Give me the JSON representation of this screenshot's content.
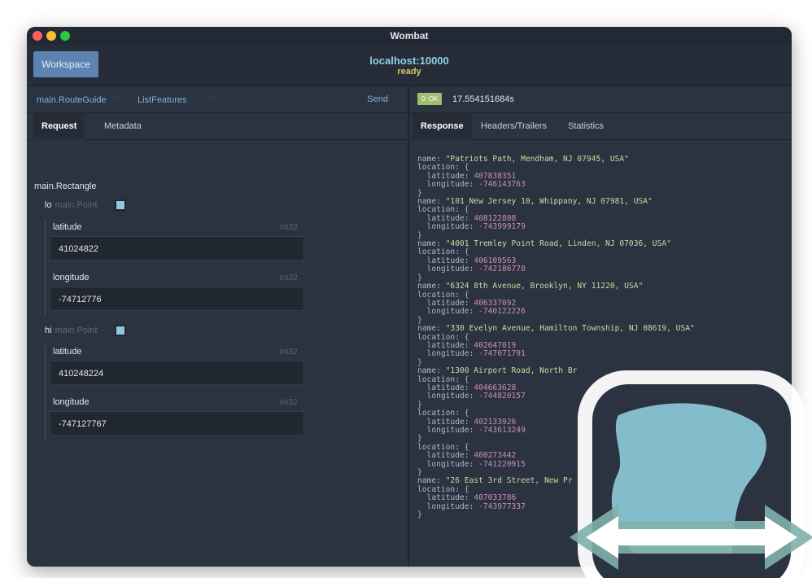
{
  "window": {
    "title": "Wombat"
  },
  "header": {
    "workspace_label": "Workspace",
    "host": "localhost:10000",
    "status": "ready"
  },
  "method_bar": {
    "service": "main.RouteGuide",
    "method": "ListFeatures",
    "send_label": "Send"
  },
  "request_tabs": [
    "Request",
    "Metadata"
  ],
  "request": {
    "root_type": "main.Rectangle",
    "lo": {
      "name": "lo",
      "type": "main.Point",
      "fields": [
        {
          "label": "latitude",
          "type": "int32",
          "value": "41024822"
        },
        {
          "label": "longitude",
          "type": "int32",
          "value": "-74712776"
        }
      ]
    },
    "hi": {
      "name": "hi",
      "type": "main.Point",
      "fields": [
        {
          "label": "latitude",
          "type": "int32",
          "value": "410248224"
        },
        {
          "label": "longitude",
          "type": "int32",
          "value": "-747127767"
        }
      ]
    }
  },
  "response_bar": {
    "status_badge": "0: OK",
    "elapsed": "17.554151684s"
  },
  "response_tabs": [
    "Response",
    "Headers/Trailers",
    "Statistics"
  ],
  "response": [
    {
      "name": "\"Patriots Path, Mendham, NJ 07945, USA\"",
      "latitude": "407838351",
      "longitude": "-746143763"
    },
    {
      "name": "\"101 New Jersey 10, Whippany, NJ 07981, USA\"",
      "latitude": "408122808",
      "longitude": "-743999179"
    },
    {
      "name": "\"4001 Tremley Point Road, Linden, NJ 07036, USA\"",
      "latitude": "406109563",
      "longitude": "-742186778"
    },
    {
      "name": "\"6324 8th Avenue, Brooklyn, NY 11220, USA\"",
      "latitude": "406337092",
      "longitude": "-740122226"
    },
    {
      "name": "\"330 Evelyn Avenue, Hamilton Township, NJ 08619, USA\"",
      "latitude": "402647019",
      "longitude": "-747071791"
    },
    {
      "name": "\"1300 Airport Road, North Br",
      "latitude": "404663628",
      "longitude": "-744820157"
    },
    {
      "name": null,
      "latitude": "402133926",
      "longitude": "-743613249"
    },
    {
      "name": null,
      "latitude": "400273442",
      "longitude": "-741220915"
    },
    {
      "name": "\"26 East 3rd Street, New Pr",
      "latitude": "407033786",
      "longitude": "-743977337"
    }
  ],
  "colors": {
    "accent": "#5b84b3",
    "host": "#8fd3e3",
    "ready": "#d9c964",
    "ok": "#9fbf6e",
    "number": "#c98fb6",
    "string": "#cfd8a3"
  },
  "logo_icon": "wombat-app-icon"
}
